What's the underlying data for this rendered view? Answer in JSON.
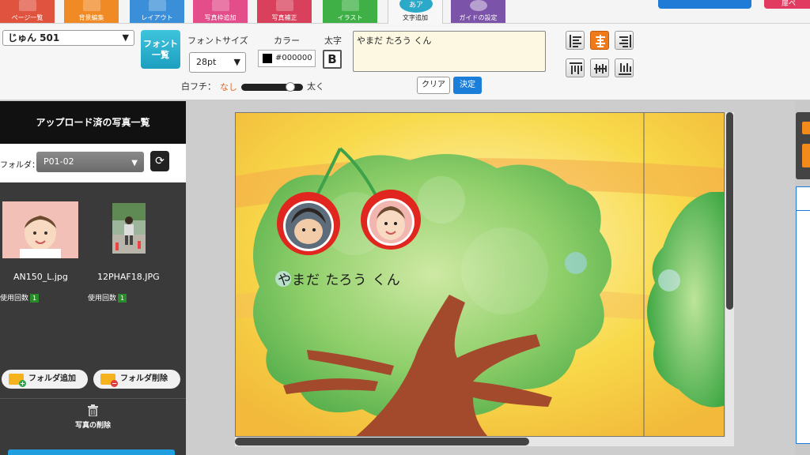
{
  "tabs": [
    {
      "label": "ページ一覧",
      "color": "#e0533f"
    },
    {
      "label": "背景編集",
      "color": "#f08a24"
    },
    {
      "label": "レイアウト",
      "color": "#3b8fd9"
    },
    {
      "label": "写真枠追加",
      "color": "#e24d8a"
    },
    {
      "label": "写真補正",
      "color": "#d9405b"
    },
    {
      "label": "イラスト",
      "color": "#3fb046"
    },
    {
      "label": "文字追加",
      "bubble": "あア",
      "active": true
    },
    {
      "label": "ガイドの設定",
      "color": "#7b53a8"
    }
  ],
  "top_right": {
    "red_button_label": "扉ペ"
  },
  "toolbar": {
    "font_name": "じゅん 501",
    "font_list_label_line1": "フォント",
    "font_list_label_line2": "一覧",
    "font_size_label": "フォントサイズ",
    "font_size_value": "28pt",
    "color_label": "カラー",
    "color_value": "#000000",
    "bold_label": "太字",
    "bold_button": "B",
    "outline_label": "白フチ：",
    "outline_none": "なし",
    "outline_thick": "太く",
    "outline_level": 0.85,
    "text_value": "やまだ たろう くん",
    "clear_label": "クリア",
    "ok_label": "決定",
    "align_active": "center"
  },
  "sidebar": {
    "title": "アップロード済の写真一覧",
    "folder_label": "フォルダ：",
    "folder_value": "P01-02",
    "photos": [
      {
        "filename": "AN150_L.jpg",
        "usage_label": "使用回数",
        "usage_count": "1"
      },
      {
        "filename": "12PHAF18.JPG",
        "usage_label": "使用回数",
        "usage_count": "1"
      }
    ],
    "add_folder_label": "フォルダ追加",
    "delete_folder_label": "フォルダ削除",
    "delete_photo_label": "写真の削除"
  },
  "canvas": {
    "name_text": "やまだ たろう くん",
    "accent_color": "#f07a1a"
  }
}
